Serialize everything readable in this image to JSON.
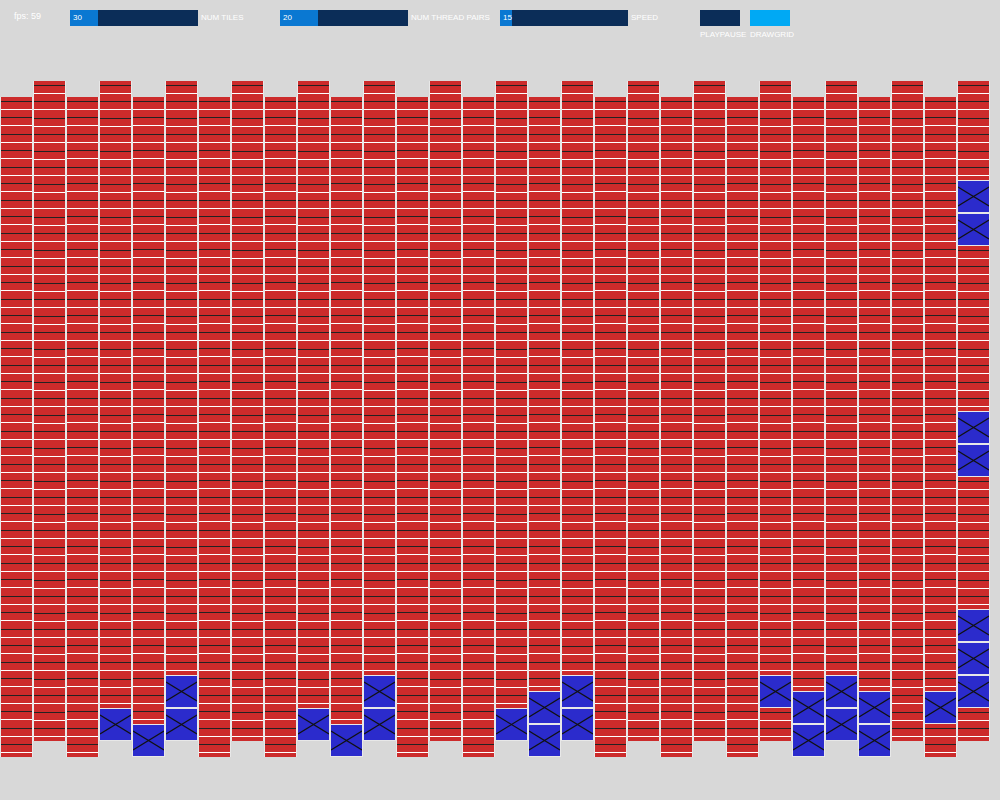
{
  "fps": "fps: 59",
  "sliders": [
    {
      "label": "NUM TILES",
      "value": "30",
      "level": 0.22
    },
    {
      "label": "NUM THREAD PAIRS",
      "value": "20",
      "level": 0.3
    },
    {
      "label": "SPEED",
      "value": "15",
      "level": 0.09
    }
  ],
  "buttons": [
    {
      "label": "PLAYPAUSE",
      "on": false
    },
    {
      "label": "DRAWGRID",
      "on": true
    }
  ],
  "weave": {
    "columns": [
      [
        false,
        false,
        false,
        false,
        false,
        false,
        false,
        false,
        false,
        false,
        false,
        false,
        false,
        false,
        false,
        false,
        false,
        false,
        false,
        false
      ],
      [
        false,
        false,
        false,
        false,
        false,
        false,
        false,
        false,
        false,
        false,
        false,
        false,
        false,
        false,
        false,
        false,
        false,
        false,
        false,
        false
      ],
      [
        false,
        false,
        false,
        false,
        false,
        false,
        false,
        false,
        false,
        false,
        false,
        false,
        false,
        false,
        false,
        false,
        false,
        false,
        false,
        false
      ],
      [
        false,
        false,
        false,
        false,
        false,
        false,
        false,
        false,
        false,
        false,
        false,
        false,
        false,
        false,
        false,
        false,
        false,
        false,
        false,
        true
      ],
      [
        false,
        false,
        false,
        false,
        false,
        false,
        false,
        false,
        false,
        false,
        false,
        false,
        false,
        false,
        false,
        false,
        false,
        false,
        false,
        true
      ],
      [
        false,
        false,
        false,
        false,
        false,
        false,
        false,
        false,
        false,
        false,
        false,
        false,
        false,
        false,
        false,
        false,
        false,
        false,
        true,
        true
      ],
      [
        false,
        false,
        false,
        false,
        false,
        false,
        false,
        false,
        false,
        false,
        false,
        false,
        false,
        false,
        false,
        false,
        false,
        false,
        false,
        false
      ],
      [
        false,
        false,
        false,
        false,
        false,
        false,
        false,
        false,
        false,
        false,
        false,
        false,
        false,
        false,
        false,
        false,
        false,
        false,
        false,
        false
      ],
      [
        false,
        false,
        false,
        false,
        false,
        false,
        false,
        false,
        false,
        false,
        false,
        false,
        false,
        false,
        false,
        false,
        false,
        false,
        false,
        false
      ],
      [
        false,
        false,
        false,
        false,
        false,
        false,
        false,
        false,
        false,
        false,
        false,
        false,
        false,
        false,
        false,
        false,
        false,
        false,
        false,
        true
      ],
      [
        false,
        false,
        false,
        false,
        false,
        false,
        false,
        false,
        false,
        false,
        false,
        false,
        false,
        false,
        false,
        false,
        false,
        false,
        false,
        true
      ],
      [
        false,
        false,
        false,
        false,
        false,
        false,
        false,
        false,
        false,
        false,
        false,
        false,
        false,
        false,
        false,
        false,
        false,
        false,
        true,
        true
      ],
      [
        false,
        false,
        false,
        false,
        false,
        false,
        false,
        false,
        false,
        false,
        false,
        false,
        false,
        false,
        false,
        false,
        false,
        false,
        false,
        false
      ],
      [
        false,
        false,
        false,
        false,
        false,
        false,
        false,
        false,
        false,
        false,
        false,
        false,
        false,
        false,
        false,
        false,
        false,
        false,
        false,
        false
      ],
      [
        false,
        false,
        false,
        false,
        false,
        false,
        false,
        false,
        false,
        false,
        false,
        false,
        false,
        false,
        false,
        false,
        false,
        false,
        false,
        false
      ],
      [
        false,
        false,
        false,
        false,
        false,
        false,
        false,
        false,
        false,
        false,
        false,
        false,
        false,
        false,
        false,
        false,
        false,
        false,
        false,
        true
      ],
      [
        false,
        false,
        false,
        false,
        false,
        false,
        false,
        false,
        false,
        false,
        false,
        false,
        false,
        false,
        false,
        false,
        false,
        false,
        true,
        true
      ],
      [
        false,
        false,
        false,
        false,
        false,
        false,
        false,
        false,
        false,
        false,
        false,
        false,
        false,
        false,
        false,
        false,
        false,
        false,
        true,
        true
      ],
      [
        false,
        false,
        false,
        false,
        false,
        false,
        false,
        false,
        false,
        false,
        false,
        false,
        false,
        false,
        false,
        false,
        false,
        false,
        false,
        false
      ],
      [
        false,
        false,
        false,
        false,
        false,
        false,
        false,
        false,
        false,
        false,
        false,
        false,
        false,
        false,
        false,
        false,
        false,
        false,
        false,
        false
      ],
      [
        false,
        false,
        false,
        false,
        false,
        false,
        false,
        false,
        false,
        false,
        false,
        false,
        false,
        false,
        false,
        false,
        false,
        false,
        false,
        false
      ],
      [
        false,
        false,
        false,
        false,
        false,
        false,
        false,
        false,
        false,
        false,
        false,
        false,
        false,
        false,
        false,
        false,
        false,
        false,
        false,
        false
      ],
      [
        false,
        false,
        false,
        false,
        false,
        false,
        false,
        false,
        false,
        false,
        false,
        false,
        false,
        false,
        false,
        false,
        false,
        false,
        false,
        false
      ],
      [
        false,
        false,
        false,
        false,
        false,
        false,
        false,
        false,
        false,
        false,
        false,
        false,
        false,
        false,
        false,
        false,
        false,
        false,
        true,
        false
      ],
      [
        false,
        false,
        false,
        false,
        false,
        false,
        false,
        false,
        false,
        false,
        false,
        false,
        false,
        false,
        false,
        false,
        false,
        false,
        true,
        true
      ],
      [
        false,
        false,
        false,
        false,
        false,
        false,
        false,
        false,
        false,
        false,
        false,
        false,
        false,
        false,
        false,
        false,
        false,
        false,
        true,
        true
      ],
      [
        false,
        false,
        false,
        false,
        false,
        false,
        false,
        false,
        false,
        false,
        false,
        false,
        false,
        false,
        false,
        false,
        false,
        false,
        true,
        true
      ],
      [
        false,
        false,
        false,
        false,
        false,
        false,
        false,
        false,
        false,
        false,
        false,
        false,
        false,
        false,
        false,
        false,
        false,
        false,
        false,
        false
      ],
      [
        false,
        false,
        false,
        false,
        false,
        false,
        false,
        false,
        false,
        false,
        false,
        false,
        false,
        false,
        false,
        false,
        false,
        false,
        true,
        false
      ],
      [
        false,
        false,
        false,
        true,
        true,
        false,
        false,
        false,
        false,
        false,
        true,
        true,
        false,
        false,
        false,
        false,
        true,
        true,
        true,
        false
      ]
    ]
  }
}
